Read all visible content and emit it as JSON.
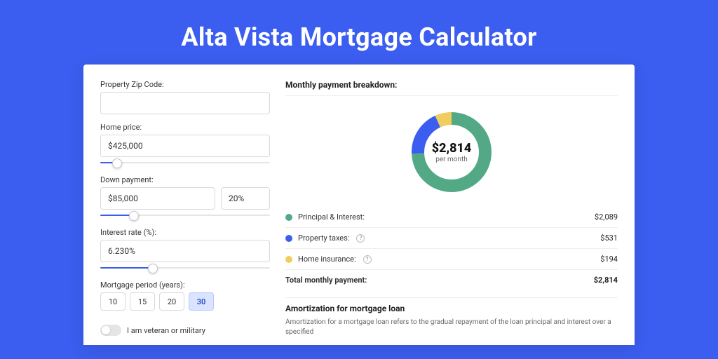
{
  "hero": {
    "title": "Alta Vista Mortgage Calculator"
  },
  "left": {
    "zip_label": "Property Zip Code:",
    "zip_value": "",
    "home_price_label": "Home price:",
    "home_price_value": "$425,000",
    "home_price_slider_pct": 10,
    "down_payment_label": "Down payment:",
    "down_payment_value": "$85,000",
    "down_payment_pct_value": "20%",
    "down_payment_slider_pct": 20,
    "interest_label": "Interest rate (%):",
    "interest_value": "6.230%",
    "interest_slider_pct": 31,
    "period_label": "Mortgage period (years):",
    "periods": [
      "10",
      "15",
      "20",
      "30"
    ],
    "period_active": "30",
    "veteran_label": "I am veteran or military"
  },
  "right": {
    "breakdown_title": "Monthly payment breakdown:",
    "donut_value": "$2,814",
    "donut_sub": "per month",
    "items": [
      {
        "label": "Principal & Interest:",
        "value": "$2,089",
        "color": "#53a986",
        "info": false
      },
      {
        "label": "Property taxes:",
        "value": "$531",
        "color": "#3b5ef0",
        "info": true
      },
      {
        "label": "Home insurance:",
        "value": "$194",
        "color": "#f0cd5e",
        "info": true
      }
    ],
    "total_label": "Total monthly payment:",
    "total_value": "$2,814",
    "amort_title": "Amortization for mortgage loan",
    "amort_text": "Amortization for a mortgage loan refers to the gradual repayment of the loan principal and interest over a specified"
  },
  "chart_data": {
    "type": "pie",
    "title": "Monthly payment breakdown",
    "series": [
      {
        "name": "Principal & Interest",
        "value": 2089,
        "color": "#53a986"
      },
      {
        "name": "Property taxes",
        "value": 531,
        "color": "#3b5ef0"
      },
      {
        "name": "Home insurance",
        "value": 194,
        "color": "#f0cd5e"
      }
    ],
    "total": 2814,
    "center_label": "$2,814",
    "center_sublabel": "per month"
  }
}
